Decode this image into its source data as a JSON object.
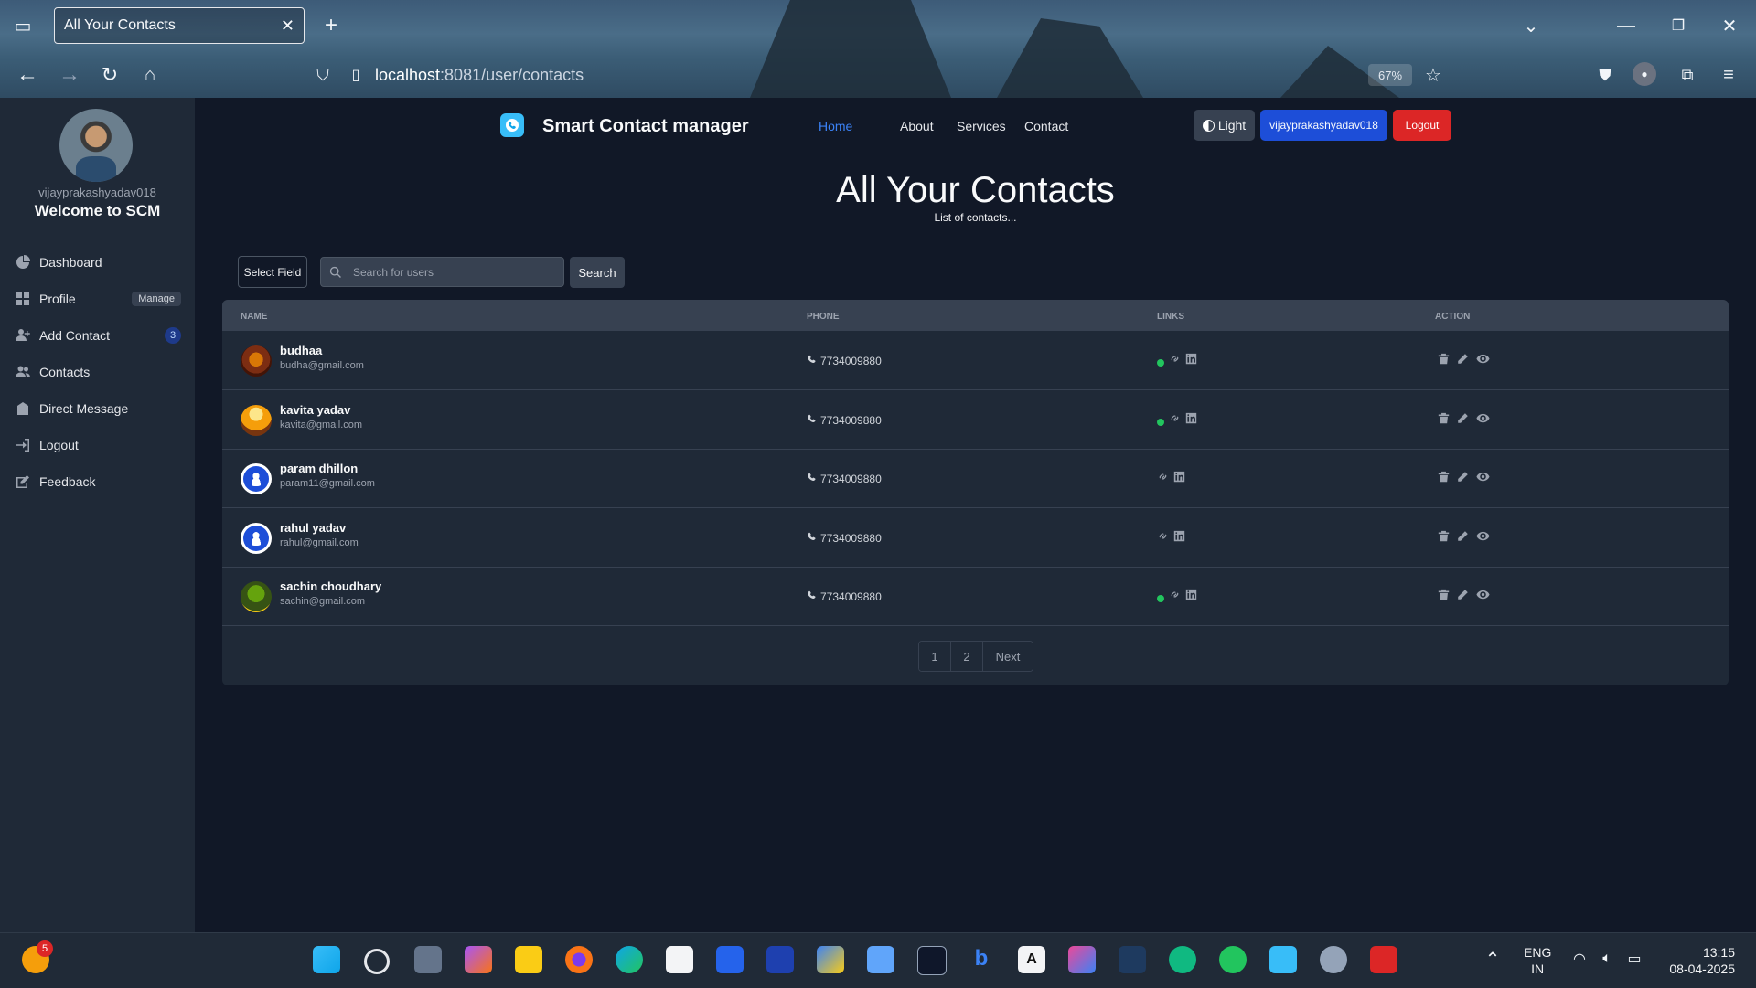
{
  "browser": {
    "tab_title": "All Your Contacts",
    "url_host": "localhost",
    "url_rest": ":8081/user/contacts",
    "zoom": "67%"
  },
  "sidebar": {
    "username": "vijayprakashyadav018",
    "welcome": "Welcome to SCM",
    "items": [
      {
        "label": "Dashboard",
        "icon": "dashboard-icon"
      },
      {
        "label": "Profile",
        "icon": "grid-icon",
        "badge": "Manage"
      },
      {
        "label": "Add Contact",
        "icon": "add-user-icon",
        "badge": "3"
      },
      {
        "label": "Contacts",
        "icon": "users-icon"
      },
      {
        "label": "Direct Message",
        "icon": "message-icon"
      },
      {
        "label": "Logout",
        "icon": "logout-icon"
      },
      {
        "label": "Feedback",
        "icon": "feedback-icon"
      }
    ]
  },
  "navbar": {
    "brand": "Smart Contact manager",
    "links": [
      "Home",
      "About",
      "Services",
      "Contact"
    ],
    "theme_button": "Light",
    "user_button": "vijayprakashyadav018",
    "logout_button": "Logout",
    "accent": "#3b82f6"
  },
  "main": {
    "title": "All Your Contacts",
    "subtitle": "List of contacts...",
    "select_field": "Select Field",
    "search_placeholder": "Search for users",
    "search_button": "Search",
    "columns": [
      "Name",
      "Phone",
      "Links",
      "Action"
    ],
    "contacts": [
      {
        "name": "budhaa",
        "email": "budha@gmail.com",
        "phone": "7734009880",
        "online": true,
        "avatar": "photo"
      },
      {
        "name": "kavita yadav",
        "email": "kavita@gmail.com",
        "phone": "7734009880",
        "online": true,
        "avatar": "photo"
      },
      {
        "name": "param dhillon",
        "email": "param11@gmail.com",
        "phone": "7734009880",
        "online": false,
        "avatar": "default"
      },
      {
        "name": "rahul yadav",
        "email": "rahul@gmail.com",
        "phone": "7734009880",
        "online": false,
        "avatar": "default"
      },
      {
        "name": "sachin choudhary",
        "email": "sachin@gmail.com",
        "phone": "7734009880",
        "online": true,
        "avatar": "photo"
      }
    ],
    "pagination": [
      "1",
      "2",
      "Next"
    ]
  },
  "taskbar": {
    "notification_count": "5",
    "lang_top": "ENG",
    "lang_bottom": "IN",
    "time": "13:15",
    "date": "08-04-2025"
  }
}
